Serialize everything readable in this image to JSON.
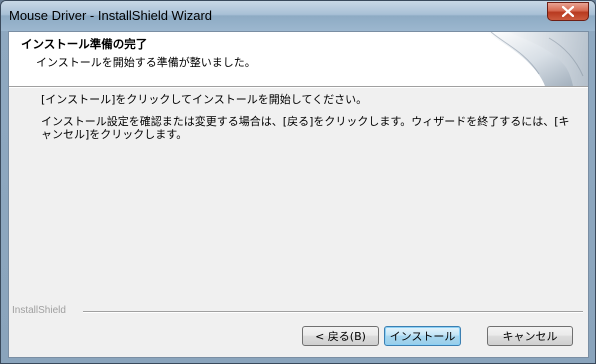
{
  "window": {
    "title": "Mouse Driver - InstallShield Wizard",
    "close_glyph": "X"
  },
  "header": {
    "title": "インストール準備の完了",
    "subtitle": "インストールを開始する準備が整いました。"
  },
  "body": {
    "line1": "[インストール]をクリックしてインストールを開始してください。",
    "line2": "インストール設定を確認または変更する場合は、[戻る]をクリックします。ウィザードを終了するには、[キャンセル]をクリックします。"
  },
  "footer": {
    "brand": "InstallShield"
  },
  "buttons": {
    "back": "< 戻る(B)",
    "install": "インストール",
    "cancel": "キャンセル"
  },
  "colors": {
    "accent_default_button": "#3c7fb1",
    "close_button": "#c8452a"
  }
}
